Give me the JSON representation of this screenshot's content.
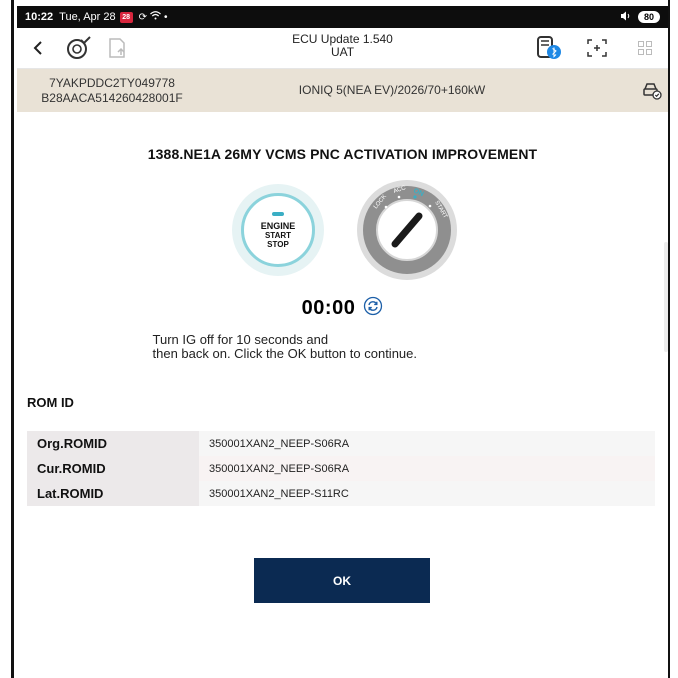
{
  "status_bar": {
    "time": "10:22",
    "date": "Tue, Apr 28",
    "calendar_badge": "28",
    "battery": "80"
  },
  "toolbar": {
    "title_line1": "ECU Update 1.540",
    "title_line2": "UAT"
  },
  "vehicle": {
    "vin_line1": "7YAKPDDC2TY049778",
    "vin_line2": "B28AACA514260428001F",
    "model": "IONIQ 5(NEA EV)/2026/70+160kW"
  },
  "main": {
    "title": "1388.NE1A 26MY VCMS PNC ACTIVATION IMPROVEMENT",
    "engine_button": {
      "line1": "ENGINE",
      "line2": "START",
      "line3": "STOP"
    },
    "ignition_labels": [
      "LOCK",
      "ACC",
      "ON",
      "START"
    ],
    "timer": "00:00",
    "instruction_line1": "Turn IG off for 10 seconds and",
    "instruction_line2": "then back on. Click the OK button to continue."
  },
  "rom": {
    "heading": "ROM ID",
    "rows": [
      {
        "label": "Org.ROMID",
        "value": "350001XAN2_NEEP-S06RA"
      },
      {
        "label": "Cur.ROMID",
        "value": "350001XAN2_NEEP-S06RA"
      },
      {
        "label": "Lat.ROMID",
        "value": "350001XAN2_NEEP-S11RC"
      }
    ]
  },
  "ok_button": {
    "label": "OK"
  },
  "colors": {
    "accent": "#0b2a52",
    "info_bar": "#e9e2d6",
    "teal": "#3aaec4"
  }
}
